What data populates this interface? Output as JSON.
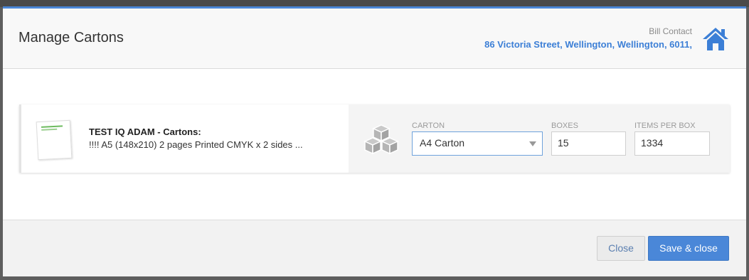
{
  "modal": {
    "title": "Manage Cartons",
    "bill_contact_label": "Bill Contact",
    "bill_contact_address": "86 Victoria Street, Wellington, Wellington, 6011,"
  },
  "product": {
    "title": "TEST IQ ADAM - Cartons:",
    "description": "!!!! A5 (148x210) 2 pages Printed CMYK x 2 sides ..."
  },
  "fields": {
    "carton_label": "CARTON",
    "carton_value": "A4 Carton",
    "boxes_label": "BOXES",
    "boxes_value": "15",
    "items_per_box_label": "ITEMS PER BOX",
    "items_per_box_value": "1334"
  },
  "footer": {
    "close_label": "Close",
    "save_close_label": "Save & close"
  },
  "colors": {
    "accent": "#4a87d8",
    "link": "#3c7fd6"
  },
  "icons": {
    "home": "home-icon",
    "cubes": "cubes-icon",
    "caret": "chevron-down-icon"
  }
}
